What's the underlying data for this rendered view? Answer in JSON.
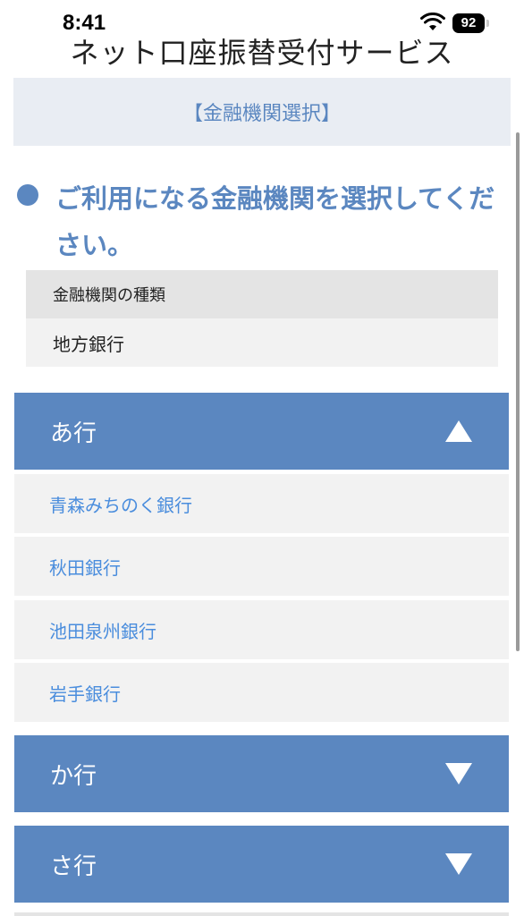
{
  "status_bar": {
    "time": "8:41",
    "battery": "92"
  },
  "app_title": "ネット口座振替受付サービス",
  "section_header": "【金融機関選択】",
  "prompt": "ご利用になる金融機関を選択してください。",
  "institution_type": {
    "label": "金融機関の種類",
    "value": "地方銀行"
  },
  "groups": [
    {
      "label": "あ行",
      "expanded": true
    },
    {
      "label": "か行",
      "expanded": false
    },
    {
      "label": "さ行",
      "expanded": false
    }
  ],
  "banks": [
    "青森みちのく銀行",
    "秋田銀行",
    "池田泉州銀行",
    "岩手銀行"
  ],
  "colors": {
    "accent": "#5b87c0",
    "link": "#4a8ddd",
    "item_bg": "#f2f2f2",
    "header_bg": "#e9edf3"
  }
}
